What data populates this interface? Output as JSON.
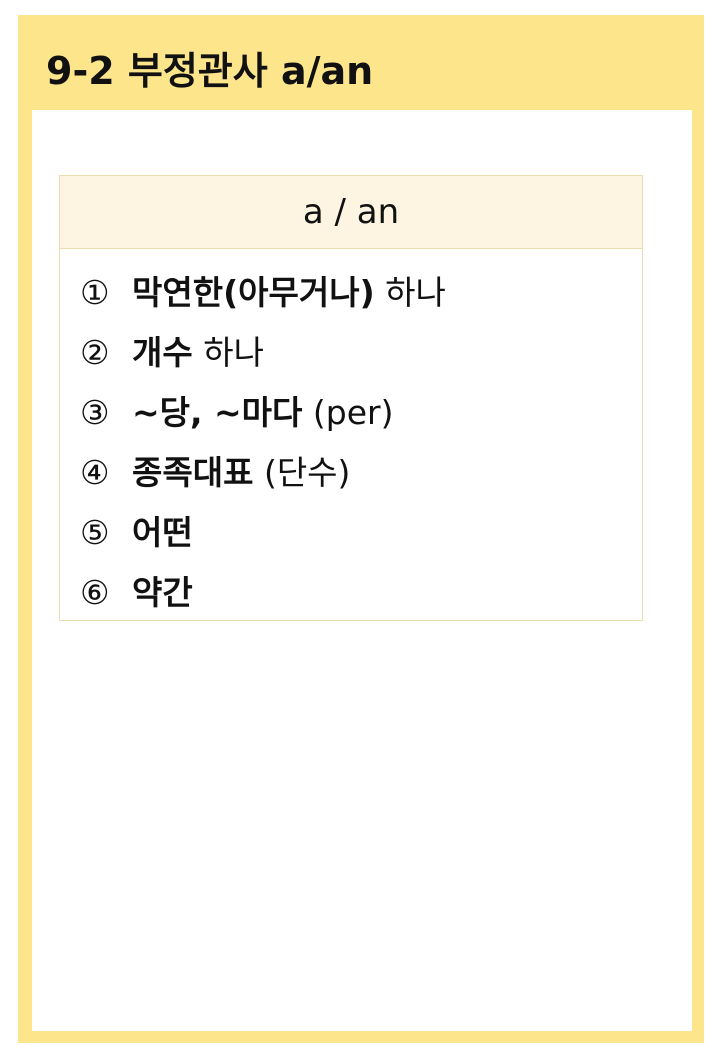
{
  "title": "9-2 부정관사 a/an",
  "card": {
    "header": "a / an",
    "items": [
      {
        "num": "①",
        "strong": "막연한(아무거나)",
        "rest": " 하나"
      },
      {
        "num": "②",
        "strong": "개수",
        "rest": " 하나"
      },
      {
        "num": "③",
        "strong": "~당, ~마다",
        "rest": " (per)"
      },
      {
        "num": "④",
        "strong": "종족대표",
        "rest": " (단수)"
      },
      {
        "num": "⑤",
        "strong": "어떤",
        "rest": ""
      },
      {
        "num": "⑥",
        "strong": "약간",
        "rest": ""
      }
    ]
  },
  "colors": {
    "frame": "#fde58c",
    "header_bg": "#fdf5e2",
    "border": "#ecdcb0",
    "text": "#111111"
  }
}
